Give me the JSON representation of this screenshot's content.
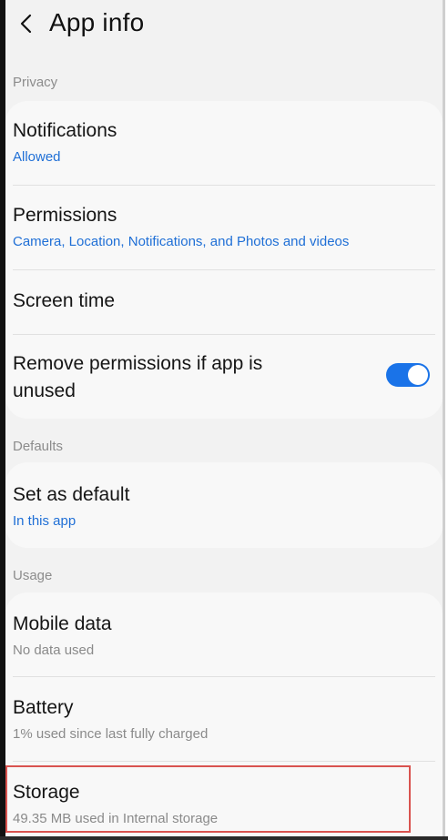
{
  "header": {
    "title": "App info"
  },
  "sections": {
    "privacy_label": "Privacy",
    "defaults_label": "Defaults",
    "usage_label": "Usage"
  },
  "privacy": {
    "notifications": {
      "title": "Notifications",
      "sub": "Allowed"
    },
    "permissions": {
      "title": "Permissions",
      "sub": "Camera, Location, Notifications, and Photos and videos"
    },
    "screen_time": {
      "title": "Screen time"
    },
    "remove_permissions": {
      "title_line1": "Remove permissions if app is",
      "title_line2": "unused",
      "toggle_state": "on"
    }
  },
  "defaults": {
    "set_as_default": {
      "title": "Set as default",
      "sub": "In this app"
    }
  },
  "usage": {
    "mobile_data": {
      "title": "Mobile data",
      "sub": "No data used"
    },
    "battery": {
      "title": "Battery",
      "sub": "1% used since last fully charged"
    },
    "storage": {
      "title": "Storage",
      "sub": "49.35 MB used in Internal storage"
    }
  },
  "colors": {
    "accent": "#1a73e8",
    "link_blue": "#1f6fd6",
    "highlight_red": "#d9534f"
  }
}
